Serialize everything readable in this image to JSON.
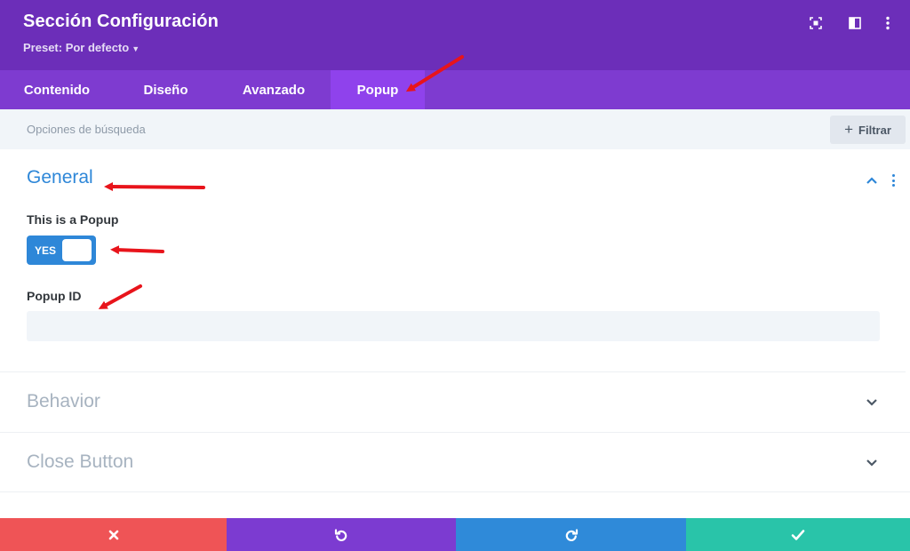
{
  "header": {
    "title": "Sección Configuración",
    "preset_label": "Preset: Por defecto",
    "icons": [
      "fullscreen-icon",
      "split-view-icon",
      "more-options-icon"
    ],
    "color": "#6c2eb9"
  },
  "tabs": [
    {
      "label": "Contenido",
      "active": false
    },
    {
      "label": "Diseño",
      "active": false
    },
    {
      "label": "Avanzado",
      "active": false
    },
    {
      "label": "Popup",
      "active": true
    }
  ],
  "search": {
    "placeholder": "Opciones de búsqueda",
    "filter_label": "Filtrar"
  },
  "sections": {
    "general": {
      "title": "General",
      "expanded": true,
      "popup_toggle_label": "This is a Popup",
      "popup_toggle_value": "YES",
      "popup_id_label": "Popup ID",
      "popup_id_value": ""
    },
    "behavior": {
      "title": "Behavior",
      "expanded": false
    },
    "close_button": {
      "title": "Close Button",
      "expanded": false
    }
  },
  "footer": {
    "buttons": [
      {
        "icon": "close-icon",
        "color": "#ef5456"
      },
      {
        "icon": "undo-icon",
        "color": "#7c3bd1"
      },
      {
        "icon": "redo-icon",
        "color": "#2f8ad9"
      },
      {
        "icon": "check-icon",
        "color": "#29c4a9"
      }
    ]
  },
  "colors": {
    "accent_blue": "#2e87d8",
    "tab_bar": "#7e3bd0",
    "active_tab": "#8f42ec",
    "annotation_arrow": "#e8141b"
  }
}
